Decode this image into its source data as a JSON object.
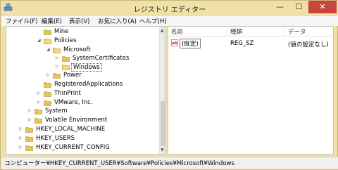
{
  "window": {
    "title": "レジストリ エディター",
    "controls": {
      "minimize": "—",
      "maximize": "☐",
      "close": "✕"
    }
  },
  "menu": [
    "ファイル(F)",
    "編集(E)",
    "表示(V)",
    "お気に入り(A)",
    "ヘルプ(H)"
  ],
  "tree": [
    {
      "label": "Mine",
      "expander": "",
      "open": false,
      "selected": false
    },
    {
      "label": "Policies",
      "expander": "◢",
      "open": true,
      "selected": false
    },
    {
      "label": "Microsoft",
      "expander": "◢",
      "open": true,
      "selected": false
    },
    {
      "label": "SystemCertificates",
      "expander": "▷",
      "open": false,
      "selected": false
    },
    {
      "label": "Windows",
      "expander": "▷",
      "open": true,
      "selected": true
    },
    {
      "label": "Power",
      "expander": "▷",
      "open": false,
      "selected": false
    },
    {
      "label": "RegisteredApplications",
      "expander": "",
      "open": false,
      "selected": false
    },
    {
      "label": "ThinPrint",
      "expander": "▷",
      "open": false,
      "selected": false
    },
    {
      "label": "VMware, Inc.",
      "expander": "▷",
      "open": false,
      "selected": false
    },
    {
      "label": "System",
      "expander": "▷",
      "open": false,
      "selected": false
    },
    {
      "label": "Volatile Environment",
      "expander": "▷",
      "open": false,
      "selected": false
    },
    {
      "label": "HKEY_LOCAL_MACHINE",
      "expander": "▷",
      "open": false,
      "selected": false
    },
    {
      "label": "HKEY_USERS",
      "expander": "▷",
      "open": false,
      "selected": false
    },
    {
      "label": "HKEY_CURRENT_CONFIG",
      "expander": "▷",
      "open": false,
      "selected": false
    }
  ],
  "list": {
    "headers": {
      "name": "名前",
      "type": "種類",
      "data": "データ"
    },
    "rows": [
      {
        "icon": "string-value-icon",
        "name": "(既定)",
        "type": "REG_SZ",
        "data": "(値の設定なし)"
      }
    ]
  },
  "statusbar": {
    "path": "コンピューター¥HKEY_CURRENT_USER¥Software¥Policies¥Microsoft¥Windows"
  },
  "colors": {
    "titlebar": "#f0e1a6",
    "close": "#c7453b",
    "folder": "#e8c35c",
    "folder_open": "#f3d77a"
  }
}
